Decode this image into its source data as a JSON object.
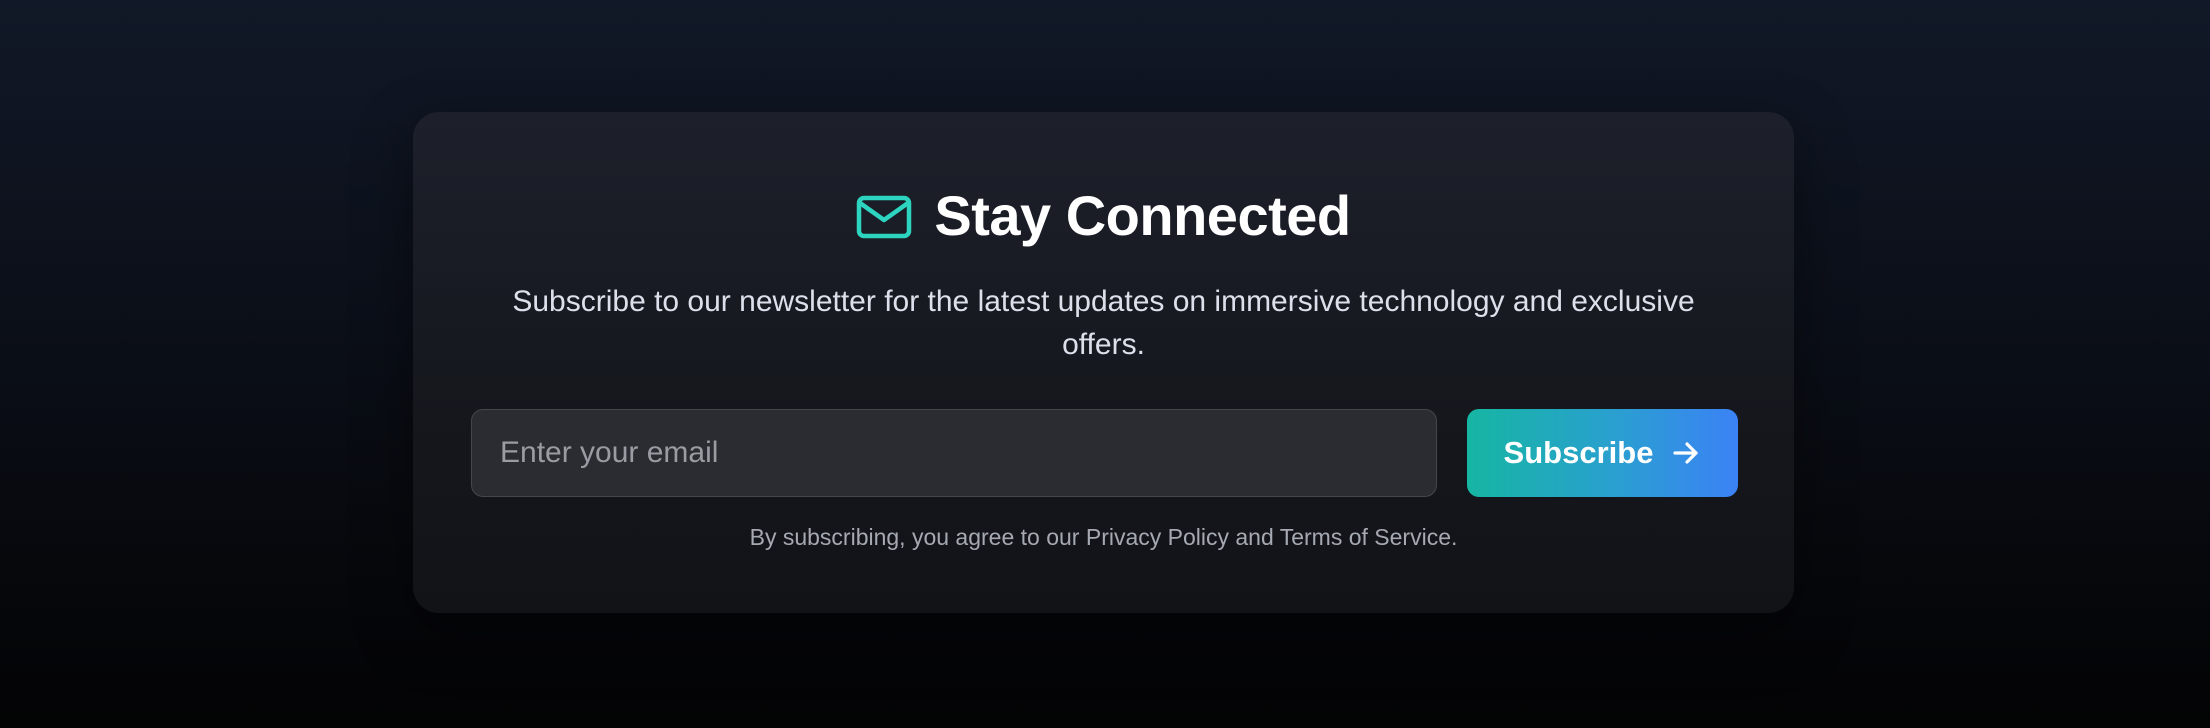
{
  "newsletter": {
    "icon": "mail-icon",
    "title": "Stay Connected",
    "description": "Subscribe to our newsletter for the latest updates on immersive technology and exclusive offers.",
    "email_input": {
      "value": "",
      "placeholder": "Enter your email"
    },
    "subscribe_button": {
      "label": "Subscribe",
      "icon": "arrow-right-icon"
    },
    "fine_print": "By subscribing, you agree to our Privacy Policy and Terms of Service."
  },
  "colors": {
    "accent_teal": "#2dd4bf",
    "button_gradient_start": "#16b6a3",
    "button_gradient_end": "#3b82f6",
    "card_background": "#1a1c23",
    "page_background": "#0b0f18"
  }
}
